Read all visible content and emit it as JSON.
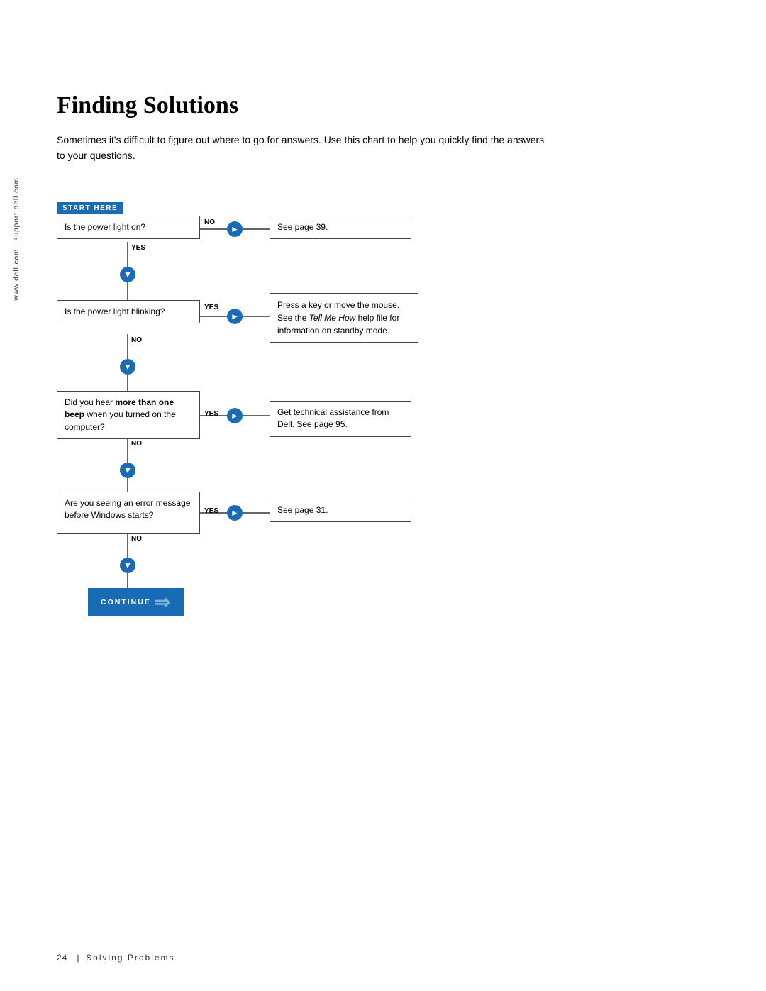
{
  "sidebar": {
    "text": "www.dell.com  |  support.dell.com"
  },
  "page": {
    "title": "Finding Solutions",
    "intro": "Sometimes it's difficult to figure out where to go for answers. Use this chart to help you quickly find the answers to your questions."
  },
  "flowchart": {
    "start_here": "START HERE",
    "q1": "Is the power light on?",
    "q1_no_answer": "See page 39.",
    "q1_yes_label": "YES",
    "q1_no_label": "NO",
    "q2": "Is the power light blinking?",
    "q2_yes_answer": "Press a key or move the mouse. See the Tell Me How help file for information on standby mode.",
    "q2_yes_label": "YES",
    "q2_no_label": "NO",
    "q3": "Did you hear more than one beep when you turned on the computer?",
    "q3_yes_answer": "Get technical assistance from Dell. See page 95.",
    "q3_yes_label": "YES",
    "q3_no_label": "NO",
    "q4": "Are you seeing an error message before Windows starts?",
    "q4_yes_answer": "See page 31.",
    "q4_yes_label": "YES",
    "q4_no_label": "NO",
    "continue_label": "CONTINUE",
    "q3_bold1": "more than one",
    "q3_bold2": "beep"
  },
  "footer": {
    "page_num": "24",
    "section": "Solving Problems"
  }
}
